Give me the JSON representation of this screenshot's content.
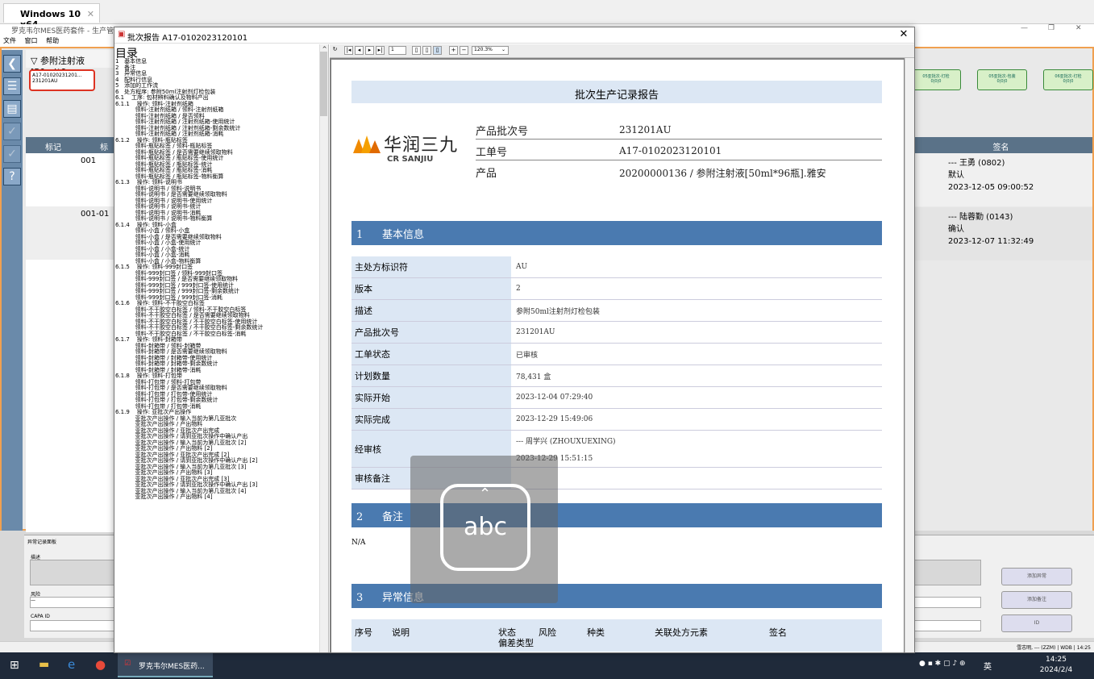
{
  "host": {
    "tab_title": "Windows 10 x64"
  },
  "app": {
    "title": "罗克韦尔MES医药套件 - 生产管",
    "menu": [
      "文件",
      "窗口",
      "帮助"
    ],
    "route_header": "参附注射液[50ml*9",
    "batch_card": {
      "line1": "A17-01020231201...",
      "line2": "231201AU"
    },
    "grid": {
      "col_mark": "标记",
      "col2": "标",
      "rows": [
        "001",
        "001-01"
      ]
    },
    "stages": [
      "05亚批次-灯检\n0|0|0",
      "05亚批次-包装\n0|0|0",
      "06亚批次-灯检\n0|0|0"
    ],
    "sign_header": "签名",
    "signatures": [
      {
        "user": "--- 王勇 (0802)",
        "action": "默认",
        "time": "2023-12-05 09:00:52"
      },
      {
        "user": "--- 陆蓉勤 (0143)",
        "action": "确认",
        "time": "2023-12-07 11:32:49"
      }
    ],
    "bottom": {
      "panel_title": "异常记录面板",
      "desc_label": "描述",
      "risk_label": "风险",
      "capa_label": "CAPA ID",
      "btn_add_exception": "添加异常",
      "btn_add_note": "添加备注",
      "btn_id": "ID"
    },
    "status_text": "雪志明, --- (ZZM) | WDB | 14:25"
  },
  "taskbar": {
    "app_label": "罗克韦尔MES医药...",
    "time": "14:25",
    "date": "2024/2/4",
    "lang": "英"
  },
  "dialog": {
    "title": "批次报告 A17-0102023120101",
    "toc_title": "目录",
    "toc": [
      "1   基本信息",
      "2   备注",
      "3   异常信息",
      "4   配料行信息",
      "5   添加的工作流",
      "6   处方程序: 参附50ml注射剂灯检包装",
      "6.1    工序: 包材辨料确认及物料产出",
      "6.1.1    操作: 领料-注射剂纸箱",
      "           领料-注射剂纸箱 / 领料-注射剂纸箱",
      "           领料-注射剂纸箱 / 是否领料",
      "           领料-注射剂纸箱 / 注射剂纸箱-使用统计",
      "           领料-注射剂纸箱 / 注射剂纸箱-剩余数统计",
      "           领料-注射剂纸箱 / 注射剂纸箱-消耗",
      "6.1.2    操作: 领料-瓶贴标签",
      "           领料-瓶贴标签 / 领料-瓶贴标签",
      "           领料-瓶贴标签 / 是否需要继续领取物料",
      "           领料-瓶贴标签 / 瓶贴标签-使用统计",
      "           领料-瓶贴标签 / 瓶贴标签-统计",
      "           领料-瓶贴标签 / 瓶贴标签-消耗",
      "           领料-瓶贴标签 / 瓶贴标签-物料衡算",
      "6.1.3    操作: 领料-说明书",
      "           领料-说明书 / 领料-说明书",
      "           领料-说明书 / 是否需要继续领取物料",
      "           领料-说明书 / 说明书-使用统计",
      "           领料-说明书 / 说明书-统计",
      "           领料-说明书 / 说明书-消耗",
      "           领料-说明书 / 说明书-物料衡算",
      "6.1.4    操作: 领料-小盒",
      "           领料-小盒 / 领料-小盒",
      "           领料-小盒 / 是否需要继续领取物料",
      "           领料-小盒 / 小盒-使用统计",
      "           领料-小盒 / 小盒-统计",
      "           领料-小盒 / 小盒-消耗",
      "           领料-小盒 / 小盒-物料衡算",
      "6.1.5    操作: 领料-999封口签",
      "           领料-999封口签 / 领料-999封口签",
      "           领料-999封口签 / 是否需要继续领取物料",
      "           领料-999封口签 / 999封口签-使用统计",
      "           领料-999封口签 / 999封口签-剩余数统计",
      "           领料-999封口签 / 999封口签-消耗",
      "6.1.6    操作: 领料-不干胶空白标签",
      "           领料-不干胶空白标签 / 领料-不干胶空白标签",
      "           领料-不干胶空白标签 / 是否需要继续领取物料",
      "           领料-不干胶空白标签 / 不干胶空白标签-使用统计",
      "           领料-不干胶空白标签 / 不干胶空白标签-剩余数统计",
      "           领料-不干胶空白标签 / 不干胶空白标签-消耗",
      "6.1.7    操作: 领料-封箱带",
      "           领料-封箱带 / 领料-封箱带",
      "           领料-封箱带 / 是否需要继续领取物料",
      "           领料-封箱带 / 封箱带-使用统计",
      "           领料-封箱带 / 封箱带-剩余数统计",
      "           领料-封箱带 / 封箱带-消耗",
      "6.1.8    操作: 领料-打包带",
      "           领料-打包带 / 领料-打包带",
      "           领料-打包带 / 是否需要继续领取物料",
      "           领料-打包带 / 打包带-使用统计",
      "           领料-打包带 / 打包带-剩余数统计",
      "           领料-打包带 / 打包带-消耗",
      "6.1.9    操作: 亚批次产出操作",
      "           亚批次产出操作 / 输入当前为第几亚批次",
      "           亚批次产出操作 / 产出物料",
      "           亚批次产出操作 / 亚批次产出完成",
      "           亚批次产出操作 / 请到亚批次操作中确认产出",
      "           亚批次产出操作 / 输入当前为第几亚批次 [2]",
      "           亚批次产出操作 / 产出物料 [2]",
      "           亚批次产出操作 / 亚批次产出完成 [2]",
      "           亚批次产出操作 / 请到亚批次操作中确认产出 [2]",
      "           亚批次产出操作 / 输入当前为第几亚批次 [3]",
      "           亚批次产出操作 / 产出物料 [3]",
      "           亚批次产出操作 / 亚批次产出完成 [3]",
      "           亚批次产出操作 / 请到亚批次操作中确认产出 [3]",
      "           亚批次产出操作 / 输入当前为第几亚批次 [4]",
      "           亚批次产出操作 / 产出物料 [4]"
    ],
    "toolbar": {
      "page": "1",
      "zoom": "120.3%"
    },
    "report": {
      "title": "批次生产记录报告",
      "logo_cn": "华润三九",
      "logo_en": "CR SANJIU",
      "header": [
        {
          "label": "产品批次号",
          "value": "231201AU"
        },
        {
          "label": "工单号",
          "value": "A17-0102023120101"
        },
        {
          "label": "产品",
          "value": "20200000136 / 参附注射液[50ml*96瓶].雅安"
        }
      ],
      "sec1": {
        "num": "1",
        "title": "基本信息"
      },
      "basic": [
        {
          "k": "主处方标识符",
          "v": "AU"
        },
        {
          "k": "版本",
          "v": "2"
        },
        {
          "k": "描述",
          "v": "参附50ml注射剂灯检包装"
        },
        {
          "k": "产品批次号",
          "v": "231201AU"
        },
        {
          "k": "工单状态",
          "v": "已审核"
        },
        {
          "k": "计划数量",
          "v": "78,431 盒"
        },
        {
          "k": "实际开始",
          "v": "2023-12-04 07:29:40"
        },
        {
          "k": "实际完成",
          "v": "2023-12-29 15:49:06"
        },
        {
          "k": "经审核",
          "v": "--- 周学兴 (ZHOUXUEXING)",
          "v2": "2023-12-29 15:51:15"
        },
        {
          "k": "审核备注",
          "v": ""
        }
      ],
      "sec2": {
        "num": "2",
        "title": "备注"
      },
      "note": "N/A",
      "sec3": {
        "num": "3",
        "title": "异常信息"
      },
      "abn_cols": {
        "c1": "序号",
        "c2": "说明",
        "c3": "状态",
        "c3b": "偏差类型",
        "c4": "风险",
        "c5": "种类",
        "c6": "关联处方元素",
        "c7": "签名"
      }
    }
  },
  "overlay": {
    "keyboard_label": "abc"
  }
}
